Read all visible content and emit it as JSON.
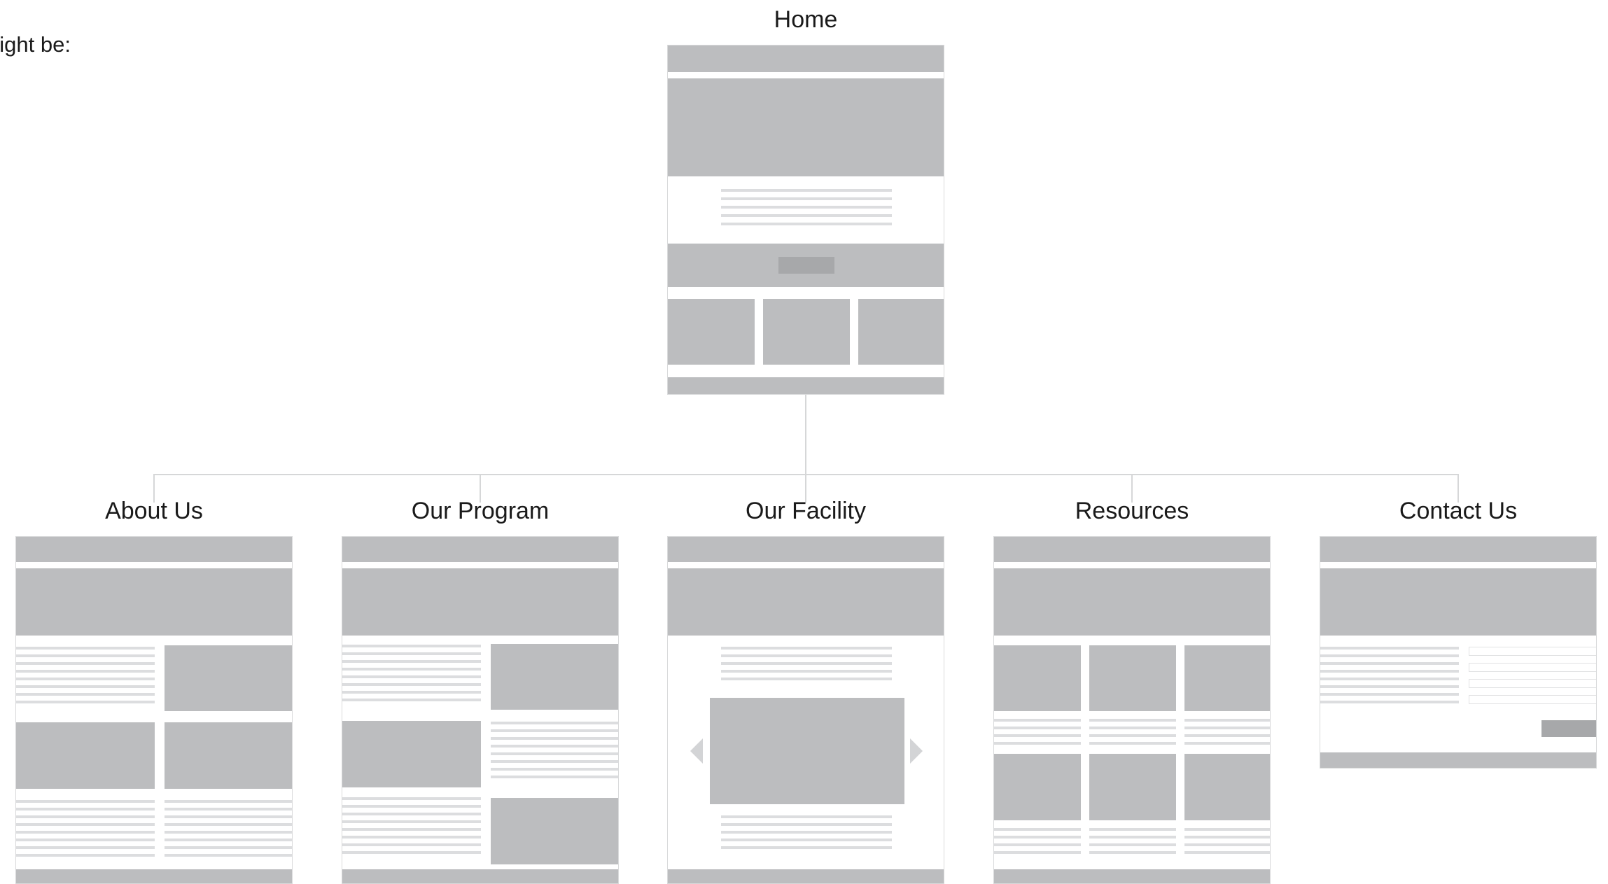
{
  "intro_text": "night be:",
  "home": {
    "title": "Home"
  },
  "pages": [
    {
      "title": "About Us"
    },
    {
      "title": "Our Program"
    },
    {
      "title": "Our Facility"
    },
    {
      "title": "Resources"
    },
    {
      "title": "Contact Us"
    }
  ],
  "colors": {
    "block": "#bcbdbf",
    "button": "#a7a8aa",
    "text_line": "#dcdddf",
    "connector": "#d6d7d8"
  }
}
